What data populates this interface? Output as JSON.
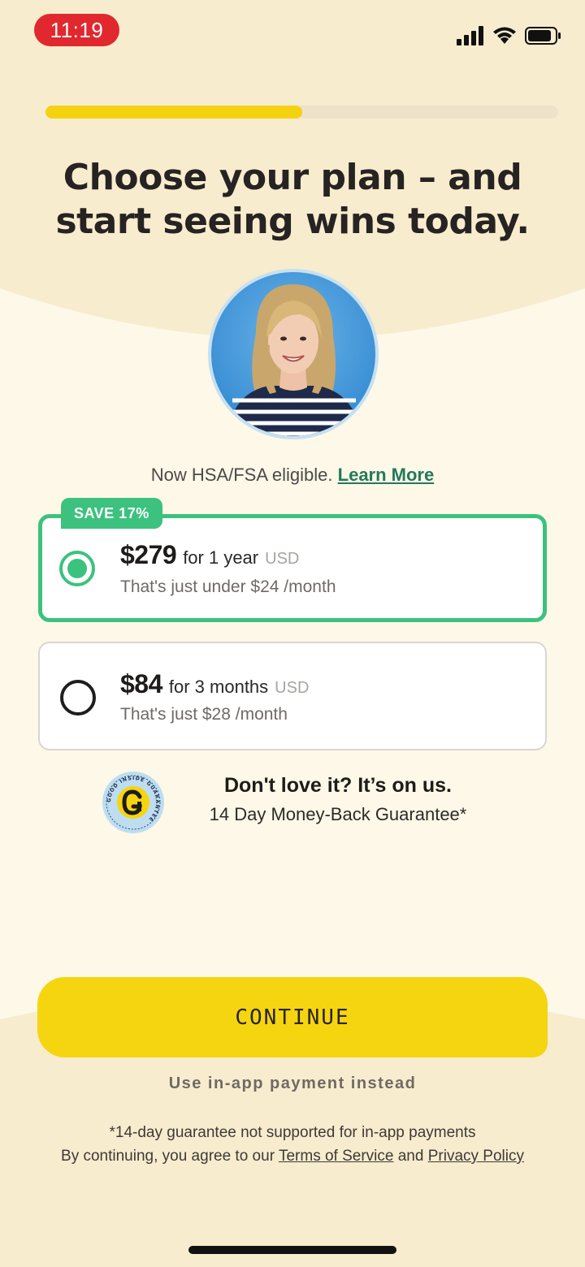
{
  "status_bar": {
    "time": "11:19"
  },
  "progress": {
    "fraction": 0.5
  },
  "headline": "Choose your plan – and start seeing wins today.",
  "hsa": {
    "text": "Now HSA/FSA eligible.",
    "link": "Learn More"
  },
  "plans": [
    {
      "badge": "SAVE 17%",
      "price": "$279",
      "period": "for 1 year",
      "currency": "USD",
      "subtext": "That's just under $24 /month",
      "selected": true
    },
    {
      "price": "$84",
      "period": "for 3 months",
      "currency": "USD",
      "subtext": "That's just $28 /month",
      "selected": false
    }
  ],
  "guarantee": {
    "title": "Don't love it? It’s on us.",
    "subtitle": "14 Day Money-Back Guarantee*",
    "seal_text": "GOOD INSIDE GUARANTEE"
  },
  "continue_label": "CONTINUE",
  "inapp_label": "Use in-app payment instead",
  "footer": {
    "note": "*14-day guarantee not supported for in-app payments",
    "agree_prefix": "By continuing, you agree to our",
    "terms": "Terms of Service",
    "and": "and",
    "privacy": "Privacy Policy"
  },
  "colors": {
    "background": "#F8ECCE",
    "accent_yellow": "#F5D50F",
    "accent_green": "#3CC27E",
    "link_green": "#24795A",
    "time_pill": "#E0282E"
  }
}
